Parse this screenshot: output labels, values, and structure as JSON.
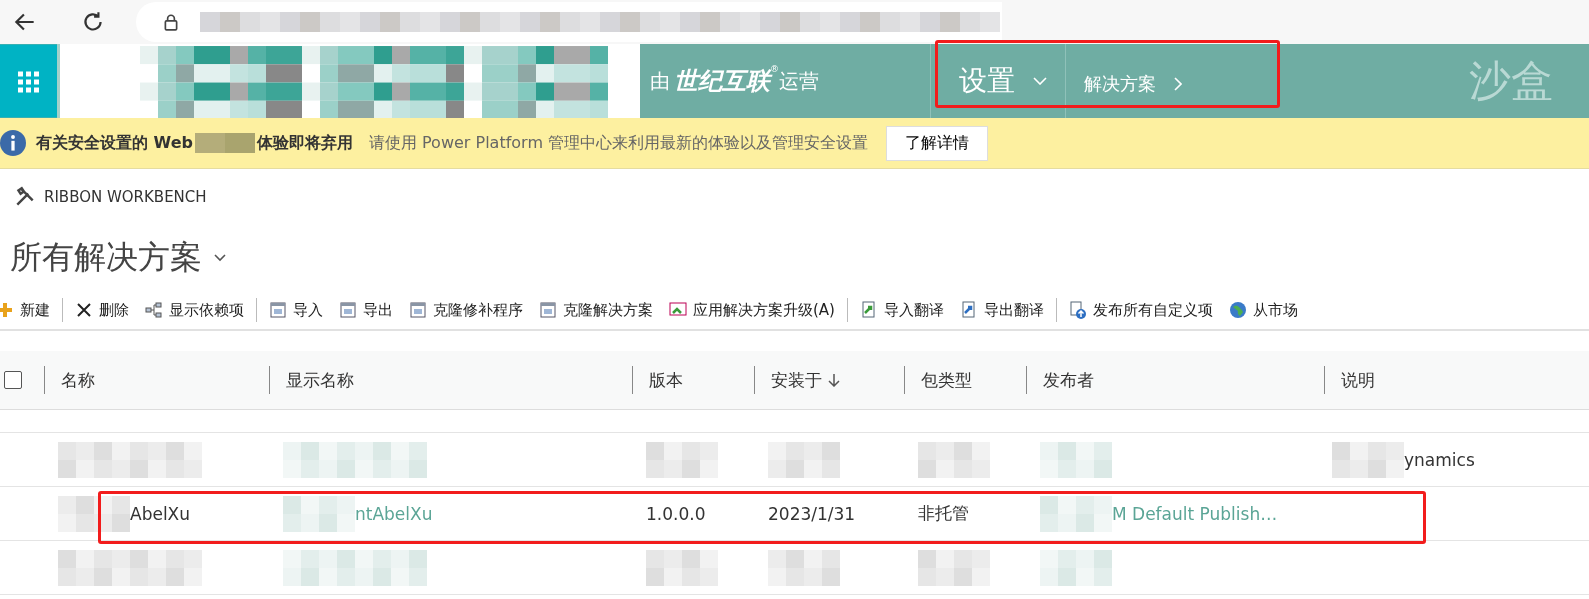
{
  "header": {
    "operator_prefix": "由",
    "operator_name": "世纪互联",
    "operator_mark": "®",
    "operator_suffix": "运营",
    "annotated": true,
    "nav": [
      {
        "label": "设置",
        "kind": "dropdown"
      },
      {
        "label": "解决方案",
        "kind": "next"
      }
    ],
    "environment": "沙盒"
  },
  "banner": {
    "title_start": "有关安全设置的 Web",
    "title_end": "体验即将弃用",
    "message": "请使用 Power Platform 管理中心来利用最新的体验以及管理安全设置",
    "button": "了解详情"
  },
  "ribbon_workbench": "RIBBON WORKBENCH",
  "view_title": "所有解决方案",
  "toolbar": [
    [
      "新建"
    ],
    [
      "删除",
      "显示依赖项"
    ],
    [
      "导入",
      "导出",
      "克隆修补程序",
      "克隆解决方案",
      "应用解决方案升级(A)"
    ],
    [
      "导入翻译",
      "导出翻译"
    ],
    [
      "发布所有自定义项",
      "从市场"
    ]
  ],
  "table": {
    "select_all_checked": false,
    "columns": [
      {
        "label": "名称",
        "kind": "text"
      },
      {
        "label": "显示名称",
        "kind": "link"
      },
      {
        "label": "版本",
        "kind": "text"
      },
      {
        "label": "安装于",
        "kind": "text",
        "sort_descending": true
      },
      {
        "label": "包类型",
        "kind": "text"
      },
      {
        "label": "发布者",
        "kind": "link"
      },
      {
        "label": "说明",
        "kind": "text"
      }
    ],
    "rows": [
      {
        "annotated": false,
        "cells": [
          {
            "kind": "redacted"
          },
          {
            "kind": "redacted"
          },
          {
            "kind": "redacted"
          },
          {
            "kind": "redacted"
          },
          {
            "kind": "redacted"
          },
          {
            "kind": "redacted"
          },
          {
            "kind": "partly_redacted",
            "text": "ynamics"
          }
        ]
      },
      {
        "annotated": true,
        "cells": [
          {
            "kind": "partly_redacted",
            "text": "AbelXu"
          },
          {
            "kind": "partly_redacted",
            "text": "ntAbelXu"
          },
          {
            "kind": "plain",
            "text": "1.0.0.0"
          },
          {
            "kind": "plain",
            "text": "2023/1/31"
          },
          {
            "kind": "plain",
            "text": "非托管"
          },
          {
            "kind": "partly_redacted",
            "text": "M Default Publish…"
          },
          {
            "kind": "empty"
          }
        ]
      },
      {
        "annotated": false,
        "cells": [
          {
            "kind": "redacted"
          },
          {
            "kind": "redacted"
          },
          {
            "kind": "redacted"
          },
          {
            "kind": "redacted"
          },
          {
            "kind": "redacted"
          },
          {
            "kind": "redacted"
          },
          {
            "kind": "empty"
          }
        ]
      }
    ]
  }
}
